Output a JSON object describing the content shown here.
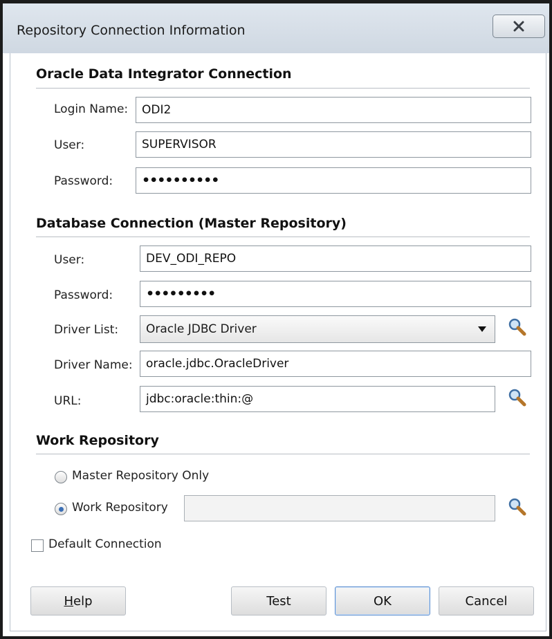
{
  "window": {
    "title": "Repository Connection Information",
    "close_icon": "close-icon"
  },
  "odi_connection": {
    "heading": "Oracle Data Integrator Connection",
    "login_name_label": "Login Name:",
    "login_name_value": "ODI2",
    "user_label": "User:",
    "user_value": "SUPERVISOR",
    "password_label": "Password:",
    "password_value": "••••••••••"
  },
  "db_connection": {
    "heading": "Database Connection (Master Repository)",
    "user_label": "User:",
    "user_value": "DEV_ODI_REPO",
    "password_label": "Password:",
    "password_value": "•••••••••",
    "driver_list_label": "Driver List:",
    "driver_list_value": "Oracle JDBC Driver",
    "driver_name_label": "Driver Name:",
    "driver_name_value": "oracle.jdbc.OracleDriver",
    "url_label": "URL:",
    "url_value": "jdbc:oracle:thin:@",
    "search_icon": "magnifier-icon"
  },
  "work_repository": {
    "heading": "Work Repository",
    "option_master_only": "Master Repository Only",
    "option_work_repository": "Work Repository",
    "selected_option": "Work Repository",
    "work_repository_value": ""
  },
  "default_connection": {
    "label": "Default Connection",
    "checked": false
  },
  "buttons": {
    "help": "Help",
    "help_mnemonic": "H",
    "help_rest": "elp",
    "test": "Test",
    "ok": "OK",
    "cancel": "Cancel"
  },
  "colors": {
    "titlebar": "#d6dee7",
    "default_button_border": "#5d8fcf",
    "radio_dot": "#3b6fb5"
  }
}
